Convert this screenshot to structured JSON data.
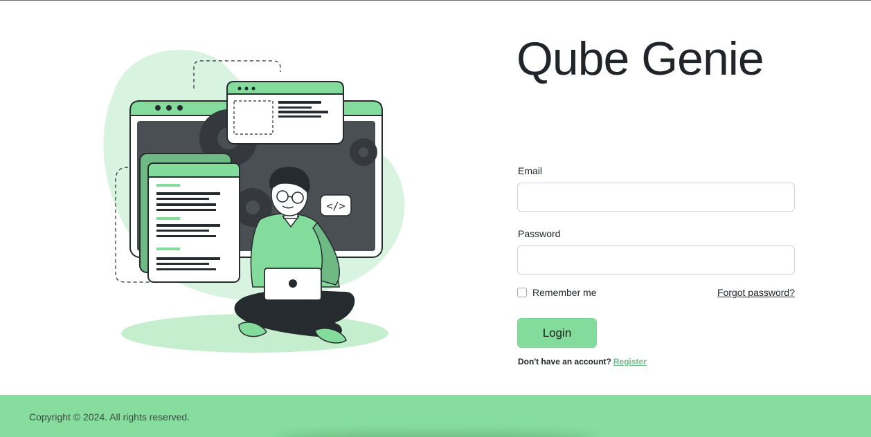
{
  "app": {
    "title": "Qube Genie"
  },
  "illustration": {
    "icon": "developer-illustration",
    "code_badge": "</>",
    "colors": {
      "accent": "#84dc9c",
      "accent_light": "#d8f3e0",
      "dark": "#262b2f",
      "screen": "#4a4f54"
    }
  },
  "form": {
    "email_label": "Email",
    "email_value": "",
    "email_placeholder": "",
    "password_label": "Password",
    "password_value": "",
    "password_placeholder": "",
    "remember_label": "Remember me",
    "remember_checked": false,
    "forgot_label": "Forgot password?",
    "login_label": "Login",
    "no_account_text": "Don't have an account?",
    "register_label": "Register"
  },
  "footer": {
    "copyright": "Copyright © 2024. All rights reserved."
  },
  "colors": {
    "brand": "#84dc9c",
    "link": "#6bbf85",
    "text": "#212529"
  }
}
